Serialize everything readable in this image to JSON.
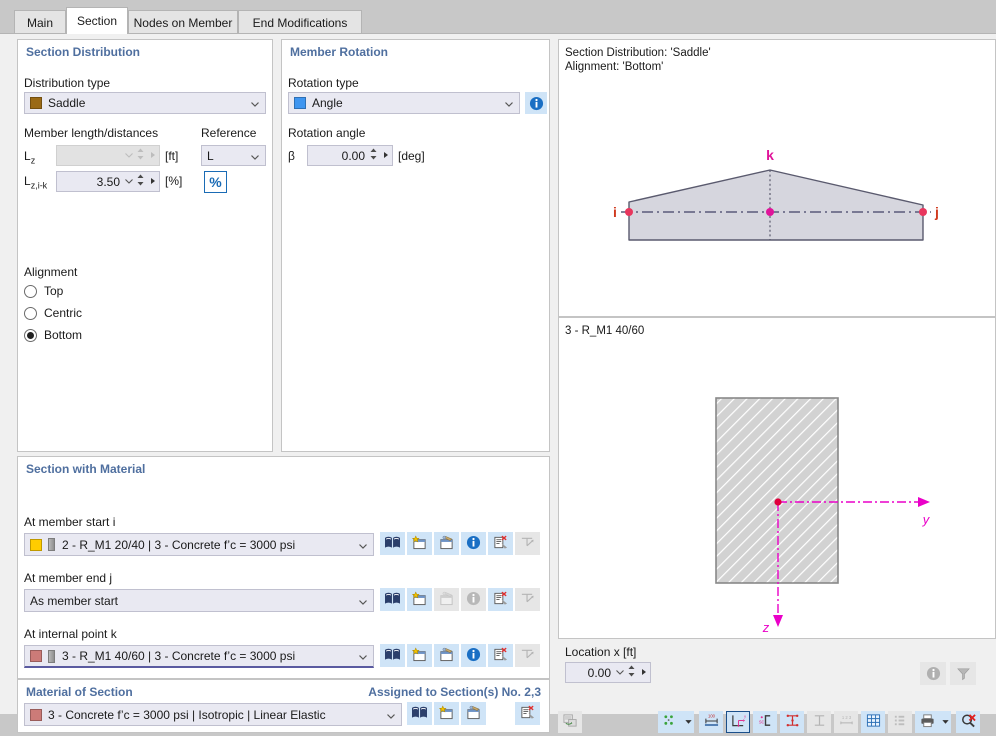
{
  "tabs": [
    {
      "label": "Main",
      "active": false
    },
    {
      "label": "Section",
      "active": true
    },
    {
      "label": "Nodes on Member",
      "active": false
    },
    {
      "label": "End Modifications",
      "active": false
    }
  ],
  "section_distribution": {
    "title": "Section Distribution",
    "distribution_type_label": "Distribution type",
    "distribution_type_value": "Saddle",
    "distribution_type_color": "#9a6a16",
    "member_length_label": "Member length/distances",
    "reference_label": "Reference",
    "rows": [
      {
        "name": "L",
        "sub": "z",
        "value": "",
        "unit": "[ft]",
        "disabled": true
      },
      {
        "name": "L",
        "sub": "z,i-k",
        "value": "3.50",
        "unit": "[%]",
        "disabled": false
      }
    ],
    "reference_value": "L",
    "percent_button_label": "%",
    "alignment_label": "Alignment",
    "alignment_options": [
      {
        "label": "Top",
        "checked": false
      },
      {
        "label": "Centric",
        "checked": false
      },
      {
        "label": "Bottom",
        "checked": true
      }
    ]
  },
  "member_rotation": {
    "title": "Member Rotation",
    "rotation_type_label": "Rotation type",
    "rotation_type_value": "Angle",
    "rotation_type_color": "#3f96f0",
    "rotation_angle_label": "Rotation angle",
    "beta_symbol": "β",
    "beta_value": "0.00",
    "beta_unit": "[deg]"
  },
  "section_with_material": {
    "title": "Section with Material",
    "rows": [
      {
        "label": "At member start i",
        "value": "2 - R_M1 20/40 | 3 - Concrete f’c = 3000 psi",
        "color": "#ffcc00",
        "has_swatch": true,
        "underline": false,
        "buttons": [
          {
            "name": "library-icon",
            "enabled": true
          },
          {
            "name": "new-section-icon",
            "enabled": true
          },
          {
            "name": "import-section-icon",
            "enabled": true
          },
          {
            "name": "info-icon",
            "enabled": true
          },
          {
            "name": "delete-section-icon",
            "enabled": true
          },
          {
            "name": "edit-tool-icon",
            "enabled": false
          }
        ]
      },
      {
        "label": "At member end j",
        "value": "As member start",
        "color": "",
        "has_swatch": false,
        "underline": false,
        "buttons": [
          {
            "name": "library-icon",
            "enabled": true
          },
          {
            "name": "new-section-icon",
            "enabled": true
          },
          {
            "name": "import-section-icon",
            "enabled": false
          },
          {
            "name": "info-icon",
            "enabled": false
          },
          {
            "name": "delete-section-icon",
            "enabled": true
          },
          {
            "name": "edit-tool-icon",
            "enabled": false
          }
        ]
      },
      {
        "label": "At internal point k",
        "value": "3 - R_M1 40/60 | 3 - Concrete f’c = 3000 psi",
        "color": "#cc7b78",
        "has_swatch": true,
        "underline": true,
        "buttons": [
          {
            "name": "library-icon",
            "enabled": true
          },
          {
            "name": "new-section-icon",
            "enabled": true
          },
          {
            "name": "import-section-icon",
            "enabled": true
          },
          {
            "name": "info-icon",
            "enabled": true
          },
          {
            "name": "delete-section-icon",
            "enabled": true
          },
          {
            "name": "edit-tool-icon",
            "enabled": false
          }
        ]
      }
    ]
  },
  "material_of_section": {
    "title": "Material of Section",
    "assigned_label": "Assigned to Section(s) No. 2,3",
    "value": "3 - Concrete f’c = 3000 psi | Isotropic | Linear Elastic",
    "color": "#cc7b78",
    "buttons": [
      {
        "name": "library-icon",
        "enabled": true
      },
      {
        "name": "new-material-icon",
        "enabled": true
      },
      {
        "name": "import-material-icon",
        "enabled": true
      },
      {
        "name": "delete-material-icon",
        "enabled": true
      }
    ]
  },
  "preview_top": {
    "line1": "Section Distribution: 'Saddle'",
    "line2": "Alignment: 'Bottom'",
    "node_i": "i",
    "node_j": "j",
    "node_k": "k",
    "node_color": "#e8365d",
    "k_color": "#e0149a",
    "fill_color": "#d6d6de",
    "stroke_color": "#5a5a6e"
  },
  "preview_bottom": {
    "title": "3 - R_M1 40/60",
    "axis_y": "y",
    "axis_z": "z",
    "axis_color": "#ea00c8",
    "fill_color": "#d2d2d2",
    "stroke_color": "#888888"
  },
  "location": {
    "label": "Location x [ft]",
    "value": "0.00",
    "info_button": "info-icon",
    "filter_button": "filter-icon"
  },
  "toolbar": {
    "buttons": [
      {
        "name": "export-view-icon",
        "enabled": false,
        "selected": false
      },
      {
        "name": "point-grid-icon",
        "enabled": true,
        "selected": false,
        "caret": true
      },
      {
        "name": "dimensions-icon",
        "enabled": true,
        "selected": false
      },
      {
        "name": "axis-system-icon",
        "enabled": true,
        "selected": true
      },
      {
        "name": "shear-center-icon",
        "enabled": true,
        "selected": false
      },
      {
        "name": "stress-points-icon",
        "enabled": true,
        "selected": false
      },
      {
        "name": "section-outline-icon",
        "enabled": false,
        "selected": false
      },
      {
        "name": "numbering-icon",
        "enabled": false,
        "selected": false
      },
      {
        "name": "grid-icon",
        "enabled": true,
        "selected": false
      },
      {
        "name": "table-icon",
        "enabled": false,
        "selected": false
      },
      {
        "name": "print-icon",
        "enabled": true,
        "selected": false,
        "caret": true
      },
      {
        "name": "zoom-reset-icon",
        "enabled": true,
        "selected": false
      }
    ]
  }
}
